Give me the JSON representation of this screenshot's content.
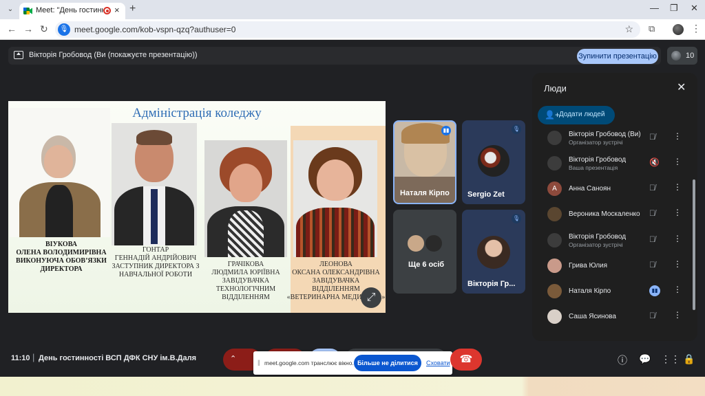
{
  "browser": {
    "tab_title": "Meet: \"День гостинності ВС",
    "url": "meet.google.com/kob-vspn-qzq?authuser=0",
    "colors": {
      "tabbar": "#dfe3eb",
      "accent": "#1a73e8"
    }
  },
  "meet": {
    "presenting_text": "Вікторія Гробовод (Ви (покажуєте презентацію))",
    "stop_presenting_label": "Зупинити презентацію",
    "participants_count": "10",
    "time": "11:10",
    "separator": "|",
    "meeting_title": "День гостинності ВСП ДФК СНУ ім.В.Даля"
  },
  "slide": {
    "title": "Адміністрація коледжу",
    "people": [
      {
        "surname": "Віукова",
        "line2": "Олена Володимирівна",
        "line3": "виконуюча обов’язки",
        "line4": "директора"
      },
      {
        "surname": "Гонтар",
        "line2": "Геннадій Андрійович",
        "line3": "заступник директора з",
        "line4": "навчальної роботи"
      },
      {
        "surname": "Грачікова",
        "line2": "Людмила Юріївна",
        "line3": "завідувачка",
        "line4": "технологічним",
        "line5": "відділенням"
      },
      {
        "surname": "Леонова",
        "line2": "Оксана Олександрівна",
        "line3": "завідувачка",
        "line4": "відділенням",
        "line5": "«Ветеринарна медицина»"
      }
    ]
  },
  "tiles": [
    {
      "name": "Наталя Кірпо",
      "speaking": true
    },
    {
      "name": "Sergio Zet",
      "speaking": false
    },
    {
      "name": "Ще 6 осіб",
      "speaking": false
    },
    {
      "name": "Вікторія Гр...",
      "speaking": false
    }
  ],
  "panel": {
    "title": "Люди",
    "add_label": "Додати людей",
    "participants": [
      {
        "name": "Вікторія Гробовод (Ви)",
        "subtitle": "Організатор зустрічі",
        "avatar_color": "#3c3c3c"
      },
      {
        "name": "Вікторія Гробовод",
        "subtitle": "Ваша презентація",
        "avatar_color": "#3c3c3c"
      },
      {
        "name": "Анна Саноян",
        "subtitle": "",
        "avatar_color": "#8d4a3c",
        "initial": "А"
      },
      {
        "name": "Вероника Москаленко",
        "subtitle": "",
        "avatar_color": "#5a4630"
      },
      {
        "name": "Вікторія Гробовод",
        "subtitle": "Організатор зустрічі",
        "avatar_color": "#3c3c3c"
      },
      {
        "name": "Грива Юлия",
        "subtitle": "",
        "avatar_color": "#c99a8a"
      },
      {
        "name": "Наталя Кірпо",
        "subtitle": "",
        "avatar_color": "#7a5a3a",
        "speaking": true
      },
      {
        "name": "Саша Ясинова",
        "subtitle": "",
        "avatar_color": "#d9d0c8"
      }
    ]
  },
  "share_popup": {
    "grip": "||",
    "text": "meet.google.com транслює вікно.",
    "stop_label": "Більше не ділитися",
    "hide_label": "Сховати"
  }
}
